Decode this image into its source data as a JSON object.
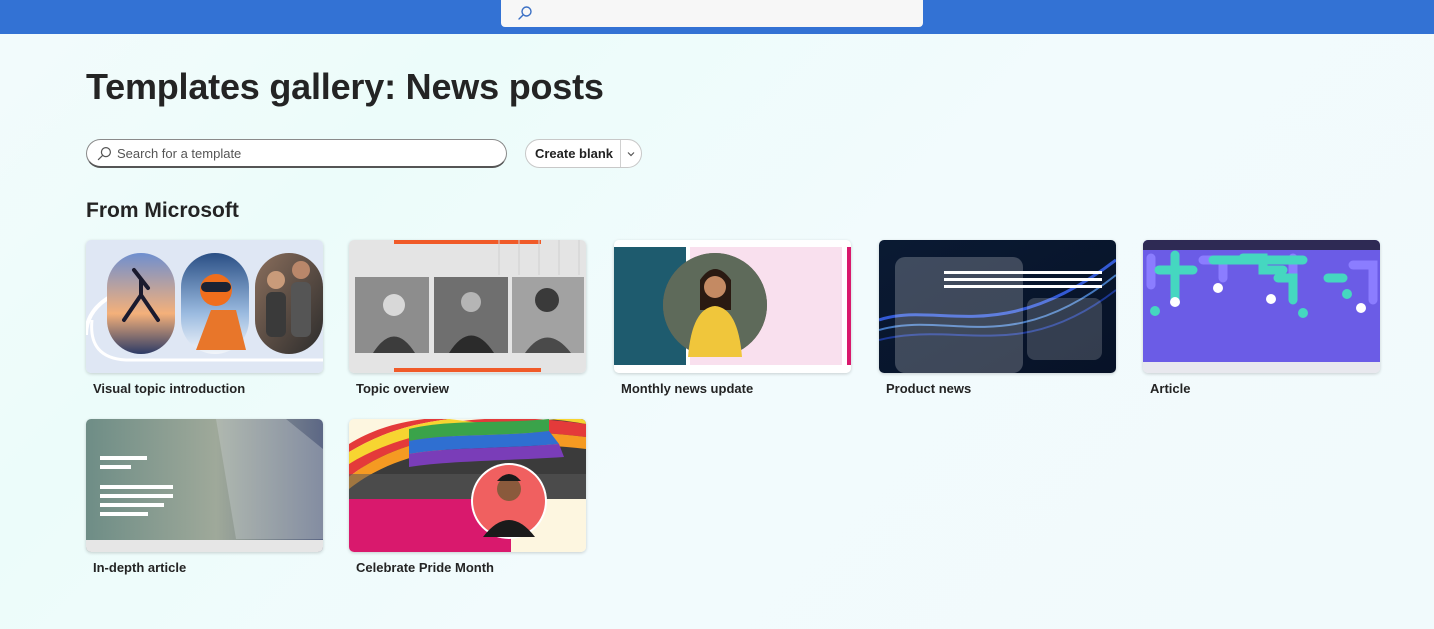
{
  "topbar": {
    "search_icon": "search-icon"
  },
  "page": {
    "title": "Templates gallery: News posts"
  },
  "toolbar": {
    "search_placeholder": "Search for a template",
    "search_icon": "search-icon",
    "create_label": "Create blank",
    "chevron_icon": "chevron-down-icon"
  },
  "section": {
    "heading": "From Microsoft"
  },
  "templates": [
    {
      "label": "Visual topic introduction"
    },
    {
      "label": "Topic overview"
    },
    {
      "label": "Monthly news update"
    },
    {
      "label": "Product news"
    },
    {
      "label": "Article"
    },
    {
      "label": "In-depth article"
    },
    {
      "label": "Celebrate Pride Month"
    }
  ],
  "colors": {
    "topbar": "#3372d4",
    "accent_orange": "#f05a28",
    "teal": "#1e5b6e",
    "pink": "#f9e0ee",
    "navy": "#0b1f3a",
    "purple": "#6b5ce6",
    "magenta": "#d9196d"
  }
}
